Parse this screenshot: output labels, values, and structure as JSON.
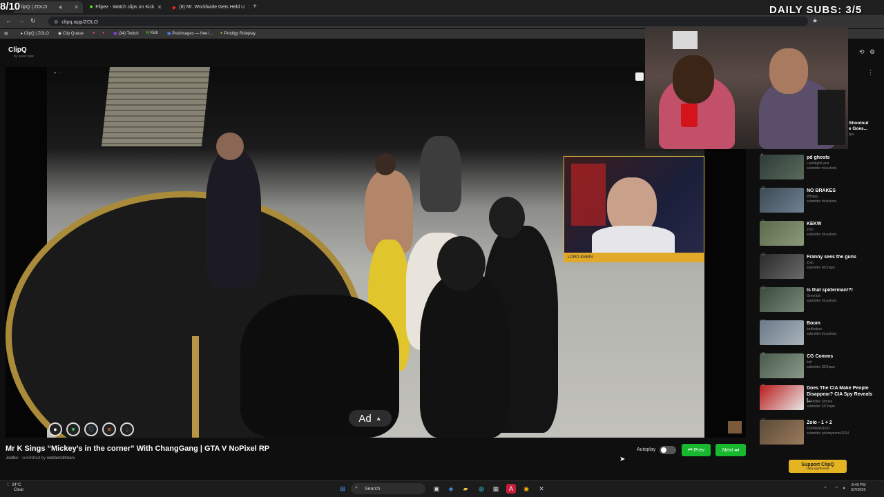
{
  "overlay": {
    "counter": "8/10",
    "daily_subs": "DAILY SUBS: 3/5"
  },
  "browser": {
    "tabs": [
      {
        "label": "ClipQ | ZOLO",
        "active": true
      },
      {
        "label": "Flipez - Watch clips on Kick",
        "active": false
      },
      {
        "label": "(8) Mr. Worldwide Gets Held U",
        "active": false
      }
    ],
    "new_tab": "+",
    "url": "clipq.app/ZOLO",
    "bookmarks": [
      "ClipQ | ZOLO",
      "Clip Queue",
      "(34) Twitch",
      "Kick",
      "Postimages — free i...",
      "Prodigy Roleplay"
    ]
  },
  "app": {
    "logo": "ClipQ",
    "logo_sub": "by await task"
  },
  "video": {
    "ad_label": "Ad",
    "title": "Mr K Sings “Mickey’s in the corner” With ChangGang | GTA V NoPixel RP",
    "creator": "Joelbiv",
    "submitted_prefix": "· submitted by",
    "submitter": "webbenditmarv",
    "overlay_cam_label": "LORD KEBIN",
    "autoplay_label": "Autoplay",
    "autoplay_on": false,
    "prev_label": "⏮ Prev",
    "next_label": "Next ⏭"
  },
  "sidebar": {
    "partial_top": {
      "title": "Shootout",
      "title2": "e Goes...",
      "sub": "lips"
    },
    "clips": [
      {
        "num": "9",
        "title": "pd ghosts",
        "creator": "LateNightLane",
        "submitter": "submitter tricashots"
      },
      {
        "num": "10",
        "title": "NO BRAKES",
        "creator": "Whippy",
        "submitter": "submitter tricashots"
      },
      {
        "num": "11",
        "title": "KEKW",
        "creator": "Zolo",
        "submitter": "submitter tricashots"
      },
      {
        "num": "12",
        "title": "Franny sees the guns",
        "creator": "Zolo",
        "submitter": "submitter ElChapo"
      },
      {
        "num": "13",
        "title": "Is that spiderman!?!",
        "creator": "Greenish",
        "submitter": "submitter tricashots"
      },
      {
        "num": "14",
        "title": "Boom",
        "creator": "lordkebun",
        "submitter": "submitter tricashots"
      },
      {
        "num": "15",
        "title": "CG Comms",
        "creator": "koil",
        "submitter": "submitter ElChapo"
      },
      {
        "num": "16",
        "title": "Does The CIA Make People Disappear? CIA Spy Reveals |...",
        "creator": "LADbible Stories",
        "submitter": "submitter ElChapo"
      },
      {
        "num": "17",
        "title": "Zolo - 1 + 2",
        "creator": "ZoloRealVEVO",
        "submitter": "submitter pickmyname2024"
      }
    ],
    "support_label": "Support ClipQ",
    "support_sub": "clipq.app/donate"
  },
  "taskbar": {
    "temperature": "24°C",
    "weather": "Clear",
    "search_placeholder": "Search",
    "time": "8:40 PM",
    "date": "3/7/2026"
  },
  "colors": {
    "accent_green": "#18b92f",
    "support_gold": "#e6b422",
    "background": "#0f0f0f"
  }
}
